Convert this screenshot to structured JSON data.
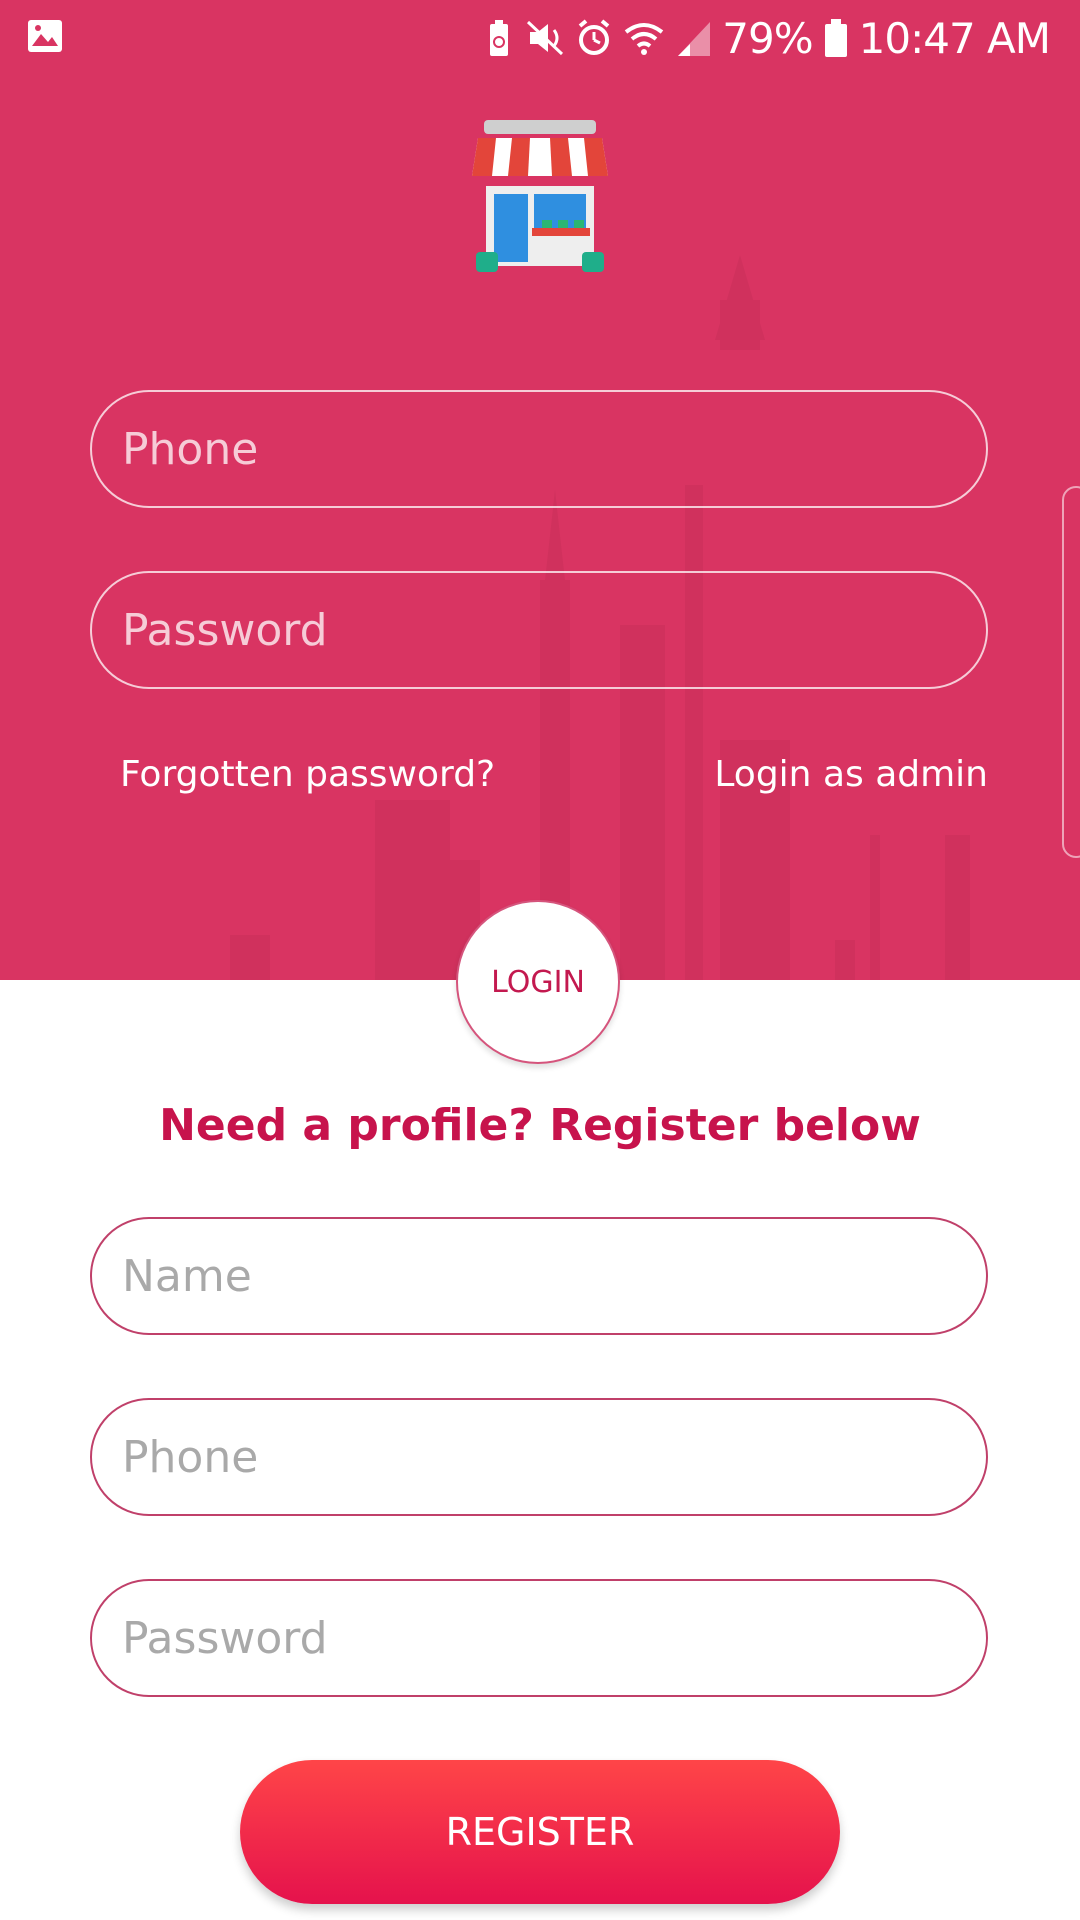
{
  "status_bar": {
    "battery_percent": "79%",
    "time": "10:47 AM",
    "icons": [
      "image-icon",
      "battery-saver-icon",
      "mute-icon",
      "alarm-icon",
      "wifi-icon",
      "signal-icon",
      "battery-icon"
    ]
  },
  "login": {
    "phone_placeholder": "Phone",
    "password_placeholder": "Password",
    "forgot_password_link": "Forgotten password?",
    "admin_login_link": "Login as admin",
    "login_button": "LOGIN"
  },
  "register": {
    "heading": "Need a profile? Register below",
    "name_placeholder": "Name",
    "phone_placeholder": "Phone",
    "password_placeholder": "Password",
    "register_button": "REGISTER"
  },
  "colors": {
    "primary": "#d93462",
    "accent": "#c7134c",
    "button_gradient_top": "#ff4548",
    "button_gradient_bottom": "#e5124c"
  }
}
